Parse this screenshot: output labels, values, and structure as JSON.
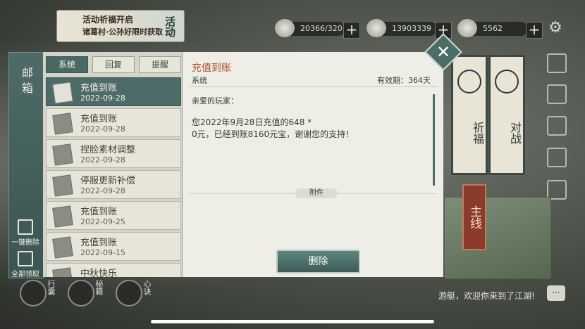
{
  "event_banner": {
    "line1": "活动祈福开启",
    "line2": "诸葛村·公孙好限时获取",
    "tag": "活动"
  },
  "resources": [
    {
      "icon": "silver-coin-icon",
      "value": "20366/320"
    },
    {
      "icon": "yuanbao-icon",
      "value": "13903339"
    },
    {
      "icon": "gift-icon",
      "value": "5562"
    }
  ],
  "altar": {
    "left_label": "祈福",
    "right_label": "对战",
    "main_line": "主线"
  },
  "mailbox": {
    "title": "邮箱",
    "tabs": [
      {
        "label": "系统",
        "active": true
      },
      {
        "label": "回复",
        "active": false
      },
      {
        "label": "提醒",
        "active": false
      }
    ],
    "delete_all": "一键删除",
    "claim_all": "全部领取",
    "items": [
      {
        "name": "充值到账",
        "date": "2022-09-28",
        "selected": true
      },
      {
        "name": "充值到账",
        "date": "2022-09-28"
      },
      {
        "name": "捏脸素材调整",
        "date": "2022-09-28"
      },
      {
        "name": "停服更新补偿",
        "date": "2022-09-28"
      },
      {
        "name": "充值到账",
        "date": "2022-09-25"
      },
      {
        "name": "充值到账",
        "date": "2022-09-15"
      },
      {
        "name": "中秋快乐",
        "date": ""
      }
    ]
  },
  "detail": {
    "title": "充值到账",
    "sender": "系统",
    "validity": "有效期：364天",
    "greeting": "亲爱的玩家：",
    "body_line1": "您2022年9月28日充值的648 *",
    "body_line2": "0元，已经到账8160元宝，谢谢您的支持！",
    "attachment_label": "附件",
    "delete_label": "删除"
  },
  "bottom": {
    "btn1": "行囊",
    "btn2": "秘籍",
    "btn3": "心诀",
    "welcome": "游艇，欢迎你来到了江湖!"
  },
  "colors": {
    "accent": "#4d6b68",
    "title_red": "#b0512c",
    "panel": "#eeeee7"
  }
}
